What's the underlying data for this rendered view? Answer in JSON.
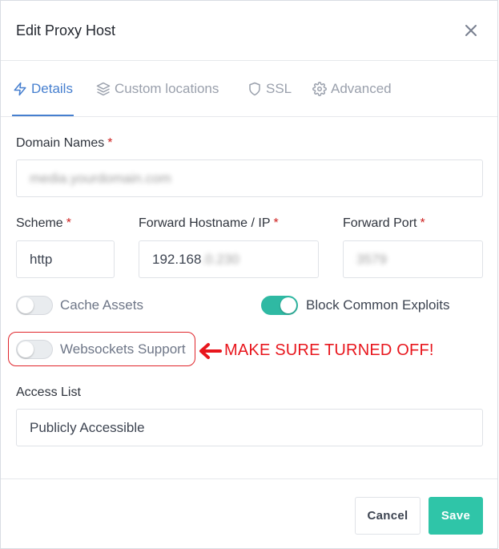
{
  "modal": {
    "title": "Edit Proxy Host",
    "close_icon": "close-icon"
  },
  "tabs": [
    {
      "label": "Details",
      "icon": "bolt-icon",
      "active": true
    },
    {
      "label": "Custom locations",
      "icon": "layers-icon",
      "active": false
    },
    {
      "label": "SSL",
      "icon": "shield-icon",
      "active": false
    },
    {
      "label": "Advanced",
      "icon": "gear-icon",
      "active": false
    }
  ],
  "form": {
    "domain_names": {
      "label": "Domain Names",
      "required_mark": "*",
      "value": "media.yourdomain.com"
    },
    "scheme": {
      "label": "Scheme",
      "required_mark": "*",
      "value": "http"
    },
    "forward_hostname": {
      "label": "Forward Hostname / IP",
      "required_mark": "*",
      "value_visible": "192.168",
      "value_blurred": ".0.230"
    },
    "forward_port": {
      "label": "Forward Port",
      "required_mark": "*",
      "value": "3579"
    },
    "cache_assets": {
      "label": "Cache Assets",
      "on": false
    },
    "block_common_exploits": {
      "label": "Block Common Exploits",
      "on": true
    },
    "websockets_support": {
      "label": "Websockets Support",
      "on": false
    },
    "access_list": {
      "label": "Access List",
      "value": "Publicly Accessible"
    }
  },
  "annotation": {
    "text": "MAKE SURE TURNED OFF!",
    "color": "#e8161d"
  },
  "footer": {
    "cancel_label": "Cancel",
    "save_label": "Save"
  },
  "colors": {
    "accent": "#467fcf",
    "toggle_on": "#2fb9a3",
    "save": "#2fc5a8",
    "required": "#cd201f"
  }
}
